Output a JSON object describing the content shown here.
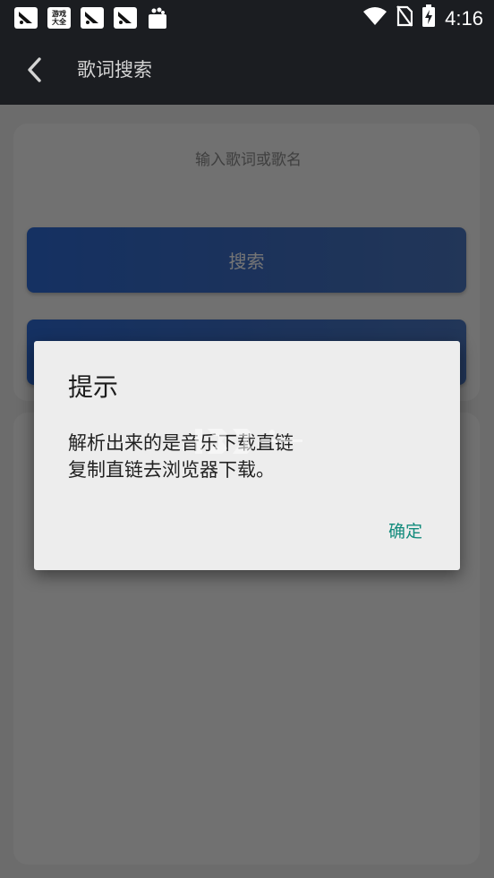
{
  "status_bar": {
    "time": "4:16",
    "app_badge_text": "游戏\n大全",
    "icons": [
      "app-icon-1",
      "app-icon-2",
      "app-icon-3",
      "app-icon-4",
      "bag-icon",
      "wifi-icon",
      "no-sim-icon",
      "battery-charging-icon"
    ]
  },
  "toolbar": {
    "title": "歌词搜索",
    "back_icon": "chevron-left-icon"
  },
  "search": {
    "placeholder": "输入歌词或歌名",
    "value": "",
    "search_button_label": "搜索",
    "second_button_label": ""
  },
  "dialog": {
    "title": "提示",
    "message_lines": [
      "解析出来的是音乐下载直链",
      "复制直链去浏览器下载。"
    ],
    "confirm_label": "确定"
  },
  "colors": {
    "accent": "#128b7c",
    "button_blue": "#3f6fc4",
    "toolbar_bg": "#1b1d21"
  }
}
